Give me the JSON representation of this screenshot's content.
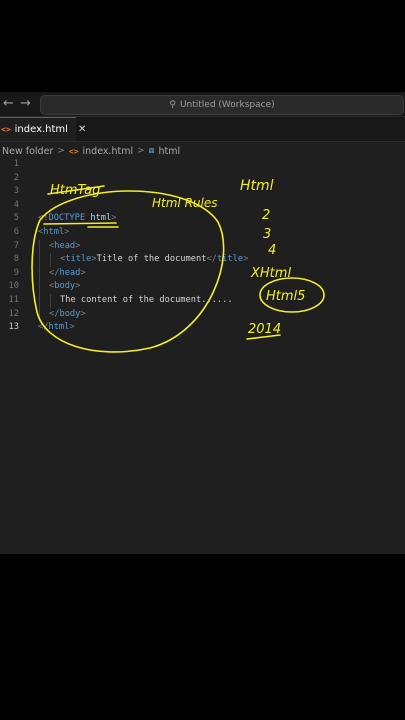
{
  "titlebar": {
    "back_icon": "arrow-left-icon",
    "forward_icon": "arrow-right-icon",
    "search_icon": "search-icon",
    "search_placeholder": "Untitled (Workspace)"
  },
  "tab": {
    "icon": "html-file-icon",
    "label": "index.html",
    "close": "✕"
  },
  "breadcrumb": {
    "folder": "New folder",
    "sep": ">",
    "file": "index.html",
    "symbol": "html",
    "file_icon": "html-file-icon",
    "symbol_icon": "cube-icon"
  },
  "editor": {
    "active_line": 13,
    "lines": [
      {
        "n": "1"
      },
      {
        "n": "2"
      },
      {
        "n": "3"
      },
      {
        "n": "4"
      },
      {
        "n": "5",
        "doctype_open": "<!",
        "doctype_kw": "DOCTYPE",
        "doctype_val": "html",
        "doctype_close": ">"
      },
      {
        "n": "6",
        "lt": "<",
        "tag": "html",
        "gt": ">"
      },
      {
        "n": "7",
        "lt": "<",
        "tag": "head",
        "gt": ">"
      },
      {
        "n": "8",
        "lt": "<",
        "tag": "title",
        "gt": ">",
        "text": "Title of the document",
        "lt2": "</",
        "tag2": "title",
        "gt2": ">"
      },
      {
        "n": "9",
        "lt": "</",
        "tag": "head",
        "gt": ">"
      },
      {
        "n": "10",
        "lt": "<",
        "tag": "body",
        "gt": ">"
      },
      {
        "n": "11",
        "text": "The content of the document......"
      },
      {
        "n": "12",
        "lt": "</",
        "tag": "body",
        "gt": ">"
      },
      {
        "n": "13",
        "lt": "</",
        "tag": "html",
        "gt": ">"
      }
    ]
  },
  "annotations": {
    "ink_color": "#f4ef22",
    "notes": [
      "HtmTag",
      "Html Rules",
      "Html",
      "2",
      "3",
      "4",
      "XHtml",
      "Html5",
      "2014"
    ]
  }
}
